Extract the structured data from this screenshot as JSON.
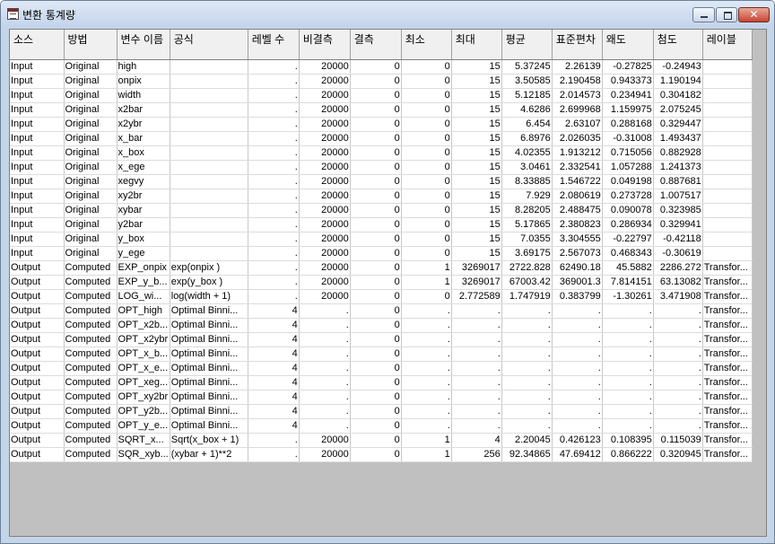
{
  "window": {
    "title": "변환 통계량",
    "icon": "table-icon"
  },
  "columns": [
    "소스",
    "방법",
    "변수 이름",
    "공식",
    "레벨 수",
    "비결측",
    "결측",
    "최소",
    "최대",
    "평균",
    "표준편차",
    "왜도",
    "첨도",
    "레이블"
  ],
  "rows": [
    [
      "Input",
      "Original",
      "high",
      "",
      ".",
      "20000",
      "0",
      "0",
      "15",
      "5.37245",
      "2.26139",
      "-0.27825",
      "-0.24943",
      ""
    ],
    [
      "Input",
      "Original",
      "onpix",
      "",
      ".",
      "20000",
      "0",
      "0",
      "15",
      "3.50585",
      "2.190458",
      "0.943373",
      "1.190194",
      ""
    ],
    [
      "Input",
      "Original",
      "width",
      "",
      ".",
      "20000",
      "0",
      "0",
      "15",
      "5.12185",
      "2.014573",
      "0.234941",
      "0.304182",
      ""
    ],
    [
      "Input",
      "Original",
      "x2bar",
      "",
      ".",
      "20000",
      "0",
      "0",
      "15",
      "4.6286",
      "2.699968",
      "1.159975",
      "2.075245",
      ""
    ],
    [
      "Input",
      "Original",
      "x2ybr",
      "",
      ".",
      "20000",
      "0",
      "0",
      "15",
      "6.454",
      "2.63107",
      "0.288168",
      "0.329447",
      ""
    ],
    [
      "Input",
      "Original",
      "x_bar",
      "",
      ".",
      "20000",
      "0",
      "0",
      "15",
      "6.8976",
      "2.026035",
      "-0.31008",
      "1.493437",
      ""
    ],
    [
      "Input",
      "Original",
      "x_box",
      "",
      ".",
      "20000",
      "0",
      "0",
      "15",
      "4.02355",
      "1.913212",
      "0.715056",
      "0.882928",
      ""
    ],
    [
      "Input",
      "Original",
      "x_ege",
      "",
      ".",
      "20000",
      "0",
      "0",
      "15",
      "3.0461",
      "2.332541",
      "1.057288",
      "1.241373",
      ""
    ],
    [
      "Input",
      "Original",
      "xegvy",
      "",
      ".",
      "20000",
      "0",
      "0",
      "15",
      "8.33885",
      "1.546722",
      "0.049198",
      "0.887681",
      ""
    ],
    [
      "Input",
      "Original",
      "xy2br",
      "",
      ".",
      "20000",
      "0",
      "0",
      "15",
      "7.929",
      "2.080619",
      "0.273728",
      "1.007517",
      ""
    ],
    [
      "Input",
      "Original",
      "xybar",
      "",
      ".",
      "20000",
      "0",
      "0",
      "15",
      "8.28205",
      "2.488475",
      "0.090078",
      "0.323985",
      ""
    ],
    [
      "Input",
      "Original",
      "y2bar",
      "",
      ".",
      "20000",
      "0",
      "0",
      "15",
      "5.17865",
      "2.380823",
      "0.286934",
      "0.329941",
      ""
    ],
    [
      "Input",
      "Original",
      "y_box",
      "",
      ".",
      "20000",
      "0",
      "0",
      "15",
      "7.0355",
      "3.304555",
      "-0.22797",
      "-0.42118",
      ""
    ],
    [
      "Input",
      "Original",
      "y_ege",
      "",
      ".",
      "20000",
      "0",
      "0",
      "15",
      "3.69175",
      "2.567073",
      "0.468343",
      "-0.30619",
      ""
    ],
    [
      "Output",
      "Computed",
      "EXP_onpix",
      "exp(onpix )",
      ".",
      "20000",
      "0",
      "1",
      "3269017",
      "2722.828",
      "62490.18",
      "45.5882",
      "2286.272",
      "Transfor..."
    ],
    [
      "Output",
      "Computed",
      "EXP_y_b...",
      "exp(y_box )",
      ".",
      "20000",
      "0",
      "1",
      "3269017",
      "67003.42",
      "369001.3",
      "7.814151",
      "63.13082",
      "Transfor..."
    ],
    [
      "Output",
      "Computed",
      "LOG_wi...",
      "log(width + 1)",
      ".",
      "20000",
      "0",
      "0",
      "2.772589",
      "1.747919",
      "0.383799",
      "-1.30261",
      "3.471908",
      "Transfor..."
    ],
    [
      "Output",
      "Computed",
      "OPT_high",
      "Optimal Binni...",
      "4",
      ".",
      "0",
      ".",
      ".",
      ".",
      ".",
      ".",
      ".",
      "Transfor..."
    ],
    [
      "Output",
      "Computed",
      "OPT_x2b...",
      "Optimal Binni...",
      "4",
      ".",
      "0",
      ".",
      ".",
      ".",
      ".",
      ".",
      ".",
      "Transfor..."
    ],
    [
      "Output",
      "Computed",
      "OPT_x2ybr",
      "Optimal Binni...",
      "4",
      ".",
      "0",
      ".",
      ".",
      ".",
      ".",
      ".",
      ".",
      "Transfor..."
    ],
    [
      "Output",
      "Computed",
      "OPT_x_b...",
      "Optimal Binni...",
      "4",
      ".",
      "0",
      ".",
      ".",
      ".",
      ".",
      ".",
      ".",
      "Transfor..."
    ],
    [
      "Output",
      "Computed",
      "OPT_x_e...",
      "Optimal Binni...",
      "4",
      ".",
      "0",
      ".",
      ".",
      ".",
      ".",
      ".",
      ".",
      "Transfor..."
    ],
    [
      "Output",
      "Computed",
      "OPT_xeg...",
      "Optimal Binni...",
      "4",
      ".",
      "0",
      ".",
      ".",
      ".",
      ".",
      ".",
      ".",
      "Transfor..."
    ],
    [
      "Output",
      "Computed",
      "OPT_xy2br",
      "Optimal Binni...",
      "4",
      ".",
      "0",
      ".",
      ".",
      ".",
      ".",
      ".",
      ".",
      "Transfor..."
    ],
    [
      "Output",
      "Computed",
      "OPT_y2b...",
      "Optimal Binni...",
      "4",
      ".",
      "0",
      ".",
      ".",
      ".",
      ".",
      ".",
      ".",
      "Transfor..."
    ],
    [
      "Output",
      "Computed",
      "OPT_y_e...",
      "Optimal Binni...",
      "4",
      ".",
      "0",
      ".",
      ".",
      ".",
      ".",
      ".",
      ".",
      "Transfor..."
    ],
    [
      "Output",
      "Computed",
      "SQRT_x...",
      "Sqrt(x_box + 1)",
      ".",
      "20000",
      "0",
      "1",
      "4",
      "2.20045",
      "0.426123",
      "0.108395",
      "0.115039",
      "Transfor..."
    ],
    [
      "Output",
      "Computed",
      "SQR_xyb...",
      "(xybar + 1)**2",
      ".",
      "20000",
      "0",
      "1",
      "256",
      "92.34865",
      "47.69412",
      "0.866222",
      "0.320945",
      "Transfor..."
    ]
  ]
}
